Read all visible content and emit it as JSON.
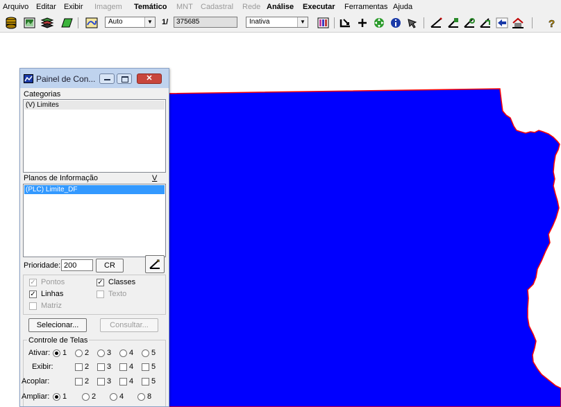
{
  "menu": {
    "items": [
      {
        "label": "Arquivo",
        "state": "enabled"
      },
      {
        "label": "Editar",
        "state": "enabled"
      },
      {
        "label": "Exibir",
        "state": "enabled"
      },
      {
        "label": "Imagem",
        "state": "disabled"
      },
      {
        "label": "Temático",
        "state": "enabled-bold"
      },
      {
        "label": "MNT",
        "state": "disabled"
      },
      {
        "label": "Cadastral",
        "state": "disabled"
      },
      {
        "label": "Rede",
        "state": "disabled"
      },
      {
        "label": "Análise",
        "state": "enabled-bold"
      },
      {
        "label": "Executar",
        "state": "enabled-bold"
      },
      {
        "label": "Ferramentas",
        "state": "enabled"
      },
      {
        "label": "Ajuda",
        "state": "enabled"
      }
    ]
  },
  "toolbar": {
    "scale_mode": "Auto",
    "scale_prefix": "1/",
    "scale_value": "375685",
    "edit_mode": "Inativa"
  },
  "map": {
    "fill_color": "#0000ff",
    "border_color": "#ff0000"
  },
  "panel": {
    "title": "Painel de Con...",
    "categorias_label": "Categorias",
    "categorias_items": [
      "(V) Limites"
    ],
    "planos_label": "Planos de Informação",
    "planos_v_button": "V",
    "planos_items": [
      "(PLC) Limite_DF"
    ],
    "prioridade_label": "Prioridade:",
    "prioridade_value": "200",
    "cr_button": "CR",
    "checks": {
      "pontos": {
        "label": "Pontos",
        "checked": true,
        "enabled": false
      },
      "classes": {
        "label": "Classes",
        "checked": true,
        "enabled": true
      },
      "linhas": {
        "label": "Linhas",
        "checked": true,
        "enabled": true
      },
      "texto": {
        "label": "Texto",
        "checked": false,
        "enabled": false
      },
      "matriz": {
        "label": "Matriz",
        "checked": false,
        "enabled": false
      }
    },
    "selecionar_button": "Selecionar...",
    "consultar_button": "Consultar...",
    "controle_label": "Controle de Telas",
    "ativar_label": "Ativar:",
    "exibir_label": "Exibir:",
    "acoplar_label": "Acoplar:",
    "ampliar_label": "Ampliar:",
    "ativar_options": [
      "1",
      "2",
      "3",
      "4",
      "5"
    ],
    "ativar_selected": "1",
    "exibir_options": [
      "2",
      "3",
      "4",
      "5"
    ],
    "acoplar_options": [
      "2",
      "3",
      "4",
      "5"
    ],
    "ampliar_options": [
      "1",
      "2",
      "4",
      "8"
    ],
    "ampliar_selected": "1"
  }
}
